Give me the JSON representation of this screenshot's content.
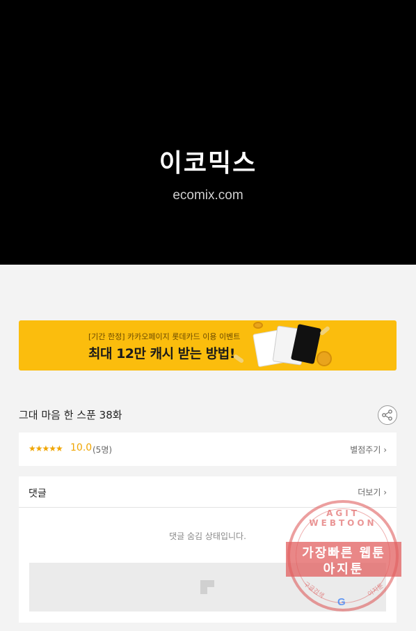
{
  "hero": {
    "logo": "이코믹스",
    "url": "ecomix.com"
  },
  "banner": {
    "subtitle": "[기간 한정] 카카오페이지 롯데카드 이용 이벤트",
    "title": "최대 12만 캐시 받는 방법!"
  },
  "episode": {
    "title": "그대 마음 한 스푼 38화",
    "share_icon": "share-icon"
  },
  "rating": {
    "stars": "★★★★★",
    "score": "10.0",
    "count": "(5명)",
    "action_label": "별점주기 ›"
  },
  "comments": {
    "title": "댓글",
    "more_label": "더보기 ›",
    "hidden_message": "댓글 숨김 상태입니다."
  },
  "stamp": {
    "arc_text": "AGIT WEBTOON",
    "line1": "가장빠른 웹툰",
    "line2": "아지툰",
    "bottom_left": "구글검색",
    "bottom_right": "아지툰",
    "google_mark": "G"
  },
  "colors": {
    "hero_bg": "#000000",
    "banner_bg": "#fbbd0d",
    "star": "#f0a500",
    "page_bg": "#f3f3f3"
  }
}
